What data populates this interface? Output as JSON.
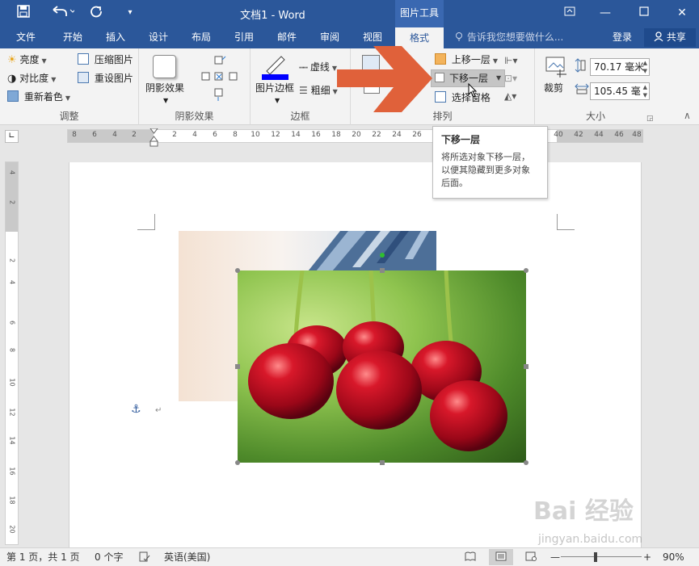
{
  "titlebar": {
    "doc_title": "文档1 - Word",
    "tools_tab": "图片工具",
    "icons": [
      "save-icon",
      "undo-icon",
      "redo-icon",
      "customize-qat-icon",
      "ribbon-display-icon",
      "minimize-icon",
      "maximize-icon",
      "close-icon"
    ]
  },
  "tabs": [
    {
      "label": "文件"
    },
    {
      "label": "开始"
    },
    {
      "label": "插入"
    },
    {
      "label": "设计"
    },
    {
      "label": "布局"
    },
    {
      "label": "引用"
    },
    {
      "label": "邮件"
    },
    {
      "label": "审阅"
    },
    {
      "label": "视图"
    },
    {
      "label": "格式",
      "active": true
    }
  ],
  "tellme": "告诉我您想要做什么...",
  "login": "登录",
  "share": "共享",
  "ribbon": {
    "adjust": {
      "label": "调整",
      "brightness": "亮度",
      "contrast": "对比度",
      "recolor": "重新着色",
      "compress": "压缩图片",
      "reset": "重设图片"
    },
    "shadow": {
      "label": "阴影效果",
      "button": "阴影效果"
    },
    "border": {
      "label": "边框",
      "picture_border": "图片边框",
      "dashes": "虚线",
      "weight": "粗细",
      "border_color": "#0000ff"
    },
    "arrange": {
      "label": "排列",
      "bring_forward": "上移一层",
      "send_backward": "下移一层",
      "selection_pane": "选择窗格"
    },
    "size": {
      "label": "大小",
      "crop": "裁剪",
      "height": "70.17 毫米",
      "width": "105.45 毫"
    }
  },
  "ruler": {
    "h_ticks": [
      "8",
      "6",
      "4",
      "2",
      "2",
      "4",
      "6",
      "8",
      "10",
      "12",
      "14",
      "16",
      "18",
      "20",
      "22",
      "24",
      "26",
      "40",
      "42",
      "44",
      "46",
      "48"
    ],
    "v_ticks": [
      "4",
      "2",
      "2",
      "4",
      "6",
      "8",
      "10",
      "12",
      "14",
      "16",
      "18",
      "20"
    ]
  },
  "tooltip": {
    "title": "下移一层",
    "desc_line1": "将所选对象下移一层，",
    "desc_line2": "以便其隐藏到更多对象",
    "desc_line3": "后面。"
  },
  "statusbar": {
    "page": "第 1 页，共 1 页",
    "words": "0 个字",
    "language": "英语(美国)",
    "zoom": "90%"
  },
  "watermark": {
    "brand": "Bai 经验",
    "url": "jingyan.baidu.com"
  }
}
